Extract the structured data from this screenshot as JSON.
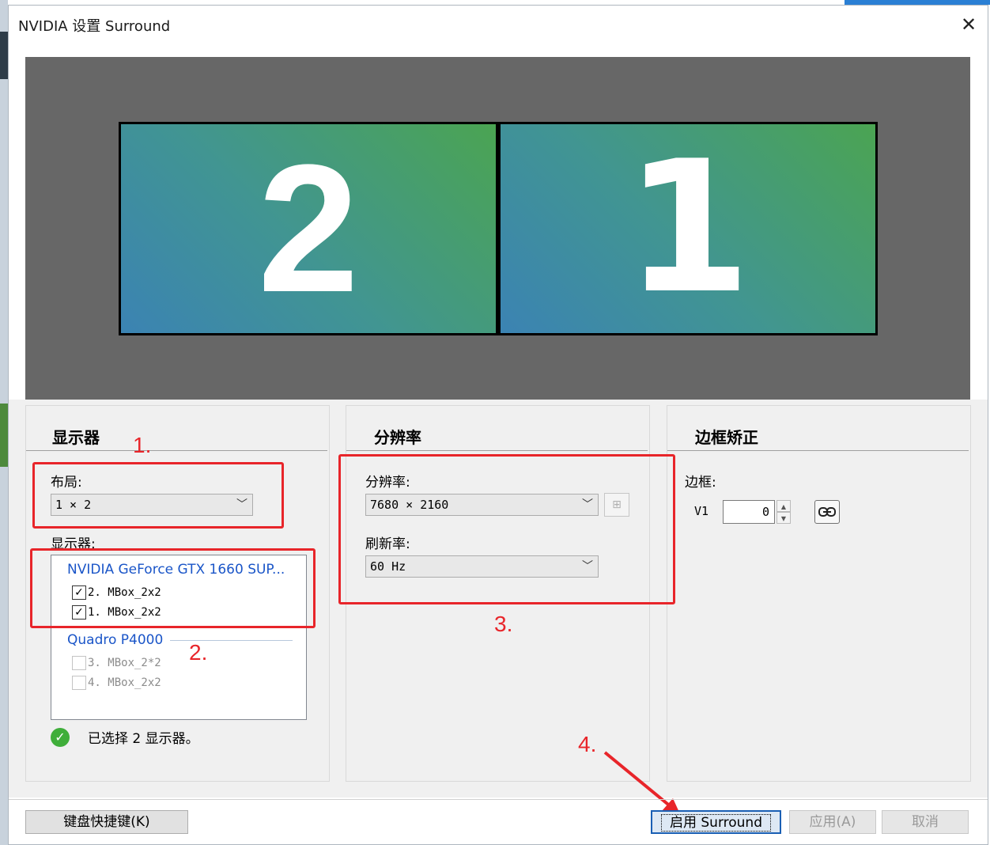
{
  "window": {
    "title": "NVIDIA 设置 Surround",
    "close_glyph": "✕"
  },
  "preview": {
    "monitors": [
      {
        "number": "2"
      },
      {
        "number": "1"
      }
    ]
  },
  "panels": {
    "displays": {
      "title": "显示器",
      "layout_label": "布局:",
      "layout_value": "1 × 2",
      "displays_label": "显示器:",
      "gpus": [
        {
          "name": "NVIDIA GeForce GTX 1660 SUP...",
          "displays": [
            {
              "label": "2. MBox_2x2",
              "checked": true
            },
            {
              "label": "1. MBox_2x2",
              "checked": true
            }
          ]
        },
        {
          "name": "Quadro P4000",
          "displays": [
            {
              "label": "3. MBox_2*2",
              "checked": false
            },
            {
              "label": "4. MBox_2x2",
              "checked": false
            }
          ]
        }
      ],
      "status": "已选择 2 显示器。"
    },
    "resolution": {
      "title": "分辨率",
      "resolution_label": "分辨率:",
      "resolution_value": "7680 × 2160",
      "refresh_label": "刷新率:",
      "refresh_value": "60 Hz"
    },
    "bezel": {
      "title": "边框矫正",
      "bezel_label": "边框:",
      "v1_label": "V1",
      "v1_value": "0"
    }
  },
  "annotations": {
    "step1": "1.",
    "step2": "2.",
    "step3": "3.",
    "step4": "4.",
    "color": "#e8252a"
  },
  "footer": {
    "shortcuts": "键盘快捷键(K)",
    "enable": "启用 Surround",
    "apply": "应用(A)",
    "cancel": "取消"
  },
  "colors": {
    "accent": "#1a55c8",
    "preview_bg": "#676767",
    "ok": "#3fae3a"
  }
}
